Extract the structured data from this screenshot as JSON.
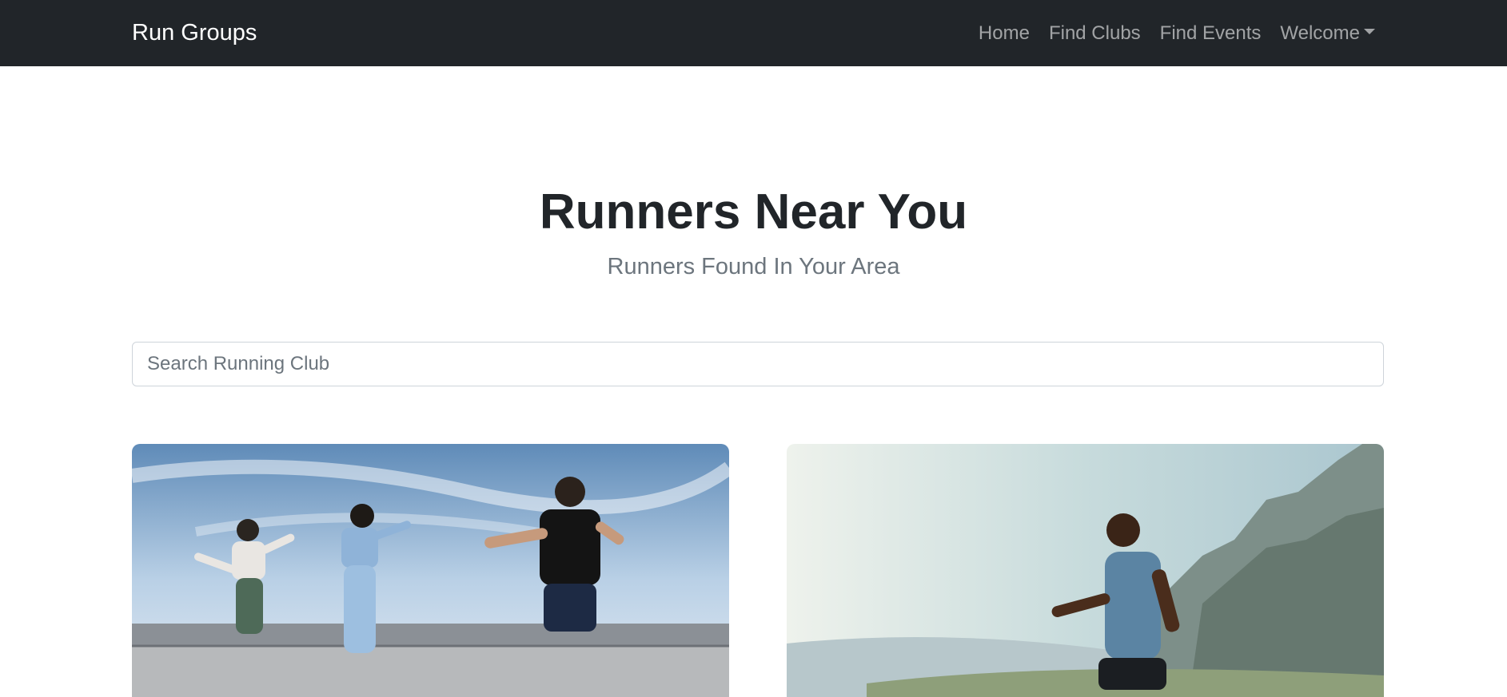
{
  "navbar": {
    "brand": "Run Groups",
    "links": [
      {
        "label": "Home"
      },
      {
        "label": "Find Clubs"
      },
      {
        "label": "Find Events"
      },
      {
        "label": "Welcome"
      }
    ]
  },
  "hero": {
    "title": "Runners Near You",
    "subtitle": "Runners Found In Your Area"
  },
  "search": {
    "placeholder": "Search Running Club",
    "value": ""
  },
  "cards": [
    {
      "image": "group-of-runners-photo"
    },
    {
      "image": "man-running-mountain-photo"
    }
  ],
  "colors": {
    "navbar_bg": "#212529",
    "heading": "#212529",
    "muted": "#6c757d"
  }
}
